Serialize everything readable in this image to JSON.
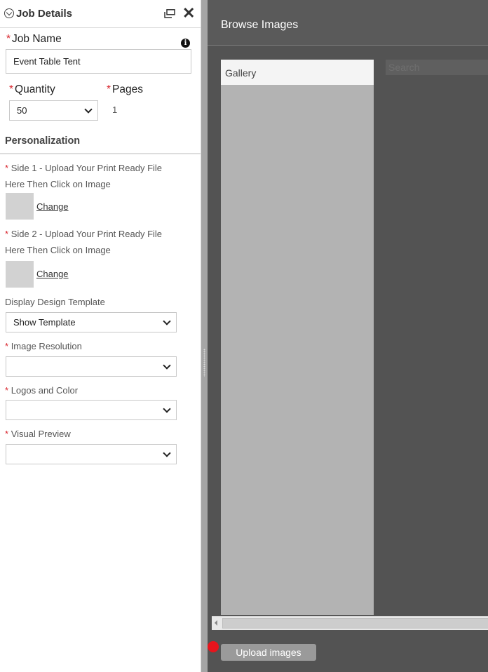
{
  "left_panel": {
    "title": "Job Details",
    "job_name": {
      "label": "Job Name",
      "value": "Event Table Tent"
    },
    "quantity": {
      "label": "Quantity",
      "value": "50"
    },
    "pages": {
      "label": "Pages",
      "value": "1"
    },
    "personalization": {
      "title": "Personalization",
      "side1_line1": "Side 1 - Upload Your Print Ready File",
      "side1_line2": "Here Then Click on Image",
      "side1_change": "Change",
      "side2_line1": "Side 2 - Upload Your Print Ready File",
      "side2_line2": "Here Then Click on Image",
      "side2_change": "Change",
      "display_template": {
        "label": "Display Design Template",
        "value": "Show Template"
      },
      "image_resolution": {
        "label": "Image Resolution",
        "value": ""
      },
      "logos_color": {
        "label": "Logos and Color",
        "value": ""
      },
      "visual_preview": {
        "label": "Visual Preview",
        "value": ""
      }
    },
    "required_mark": "*"
  },
  "browse": {
    "title": "Browse Images",
    "gallery_label": "Gallery",
    "search_placeholder": "Search",
    "upload_button": "Upload images"
  },
  "colors": {
    "required": "#d9262e",
    "right_panel_bg": "#535353",
    "gallery_bg": "#b3b3b3",
    "upload_dot": "#e8141c"
  }
}
